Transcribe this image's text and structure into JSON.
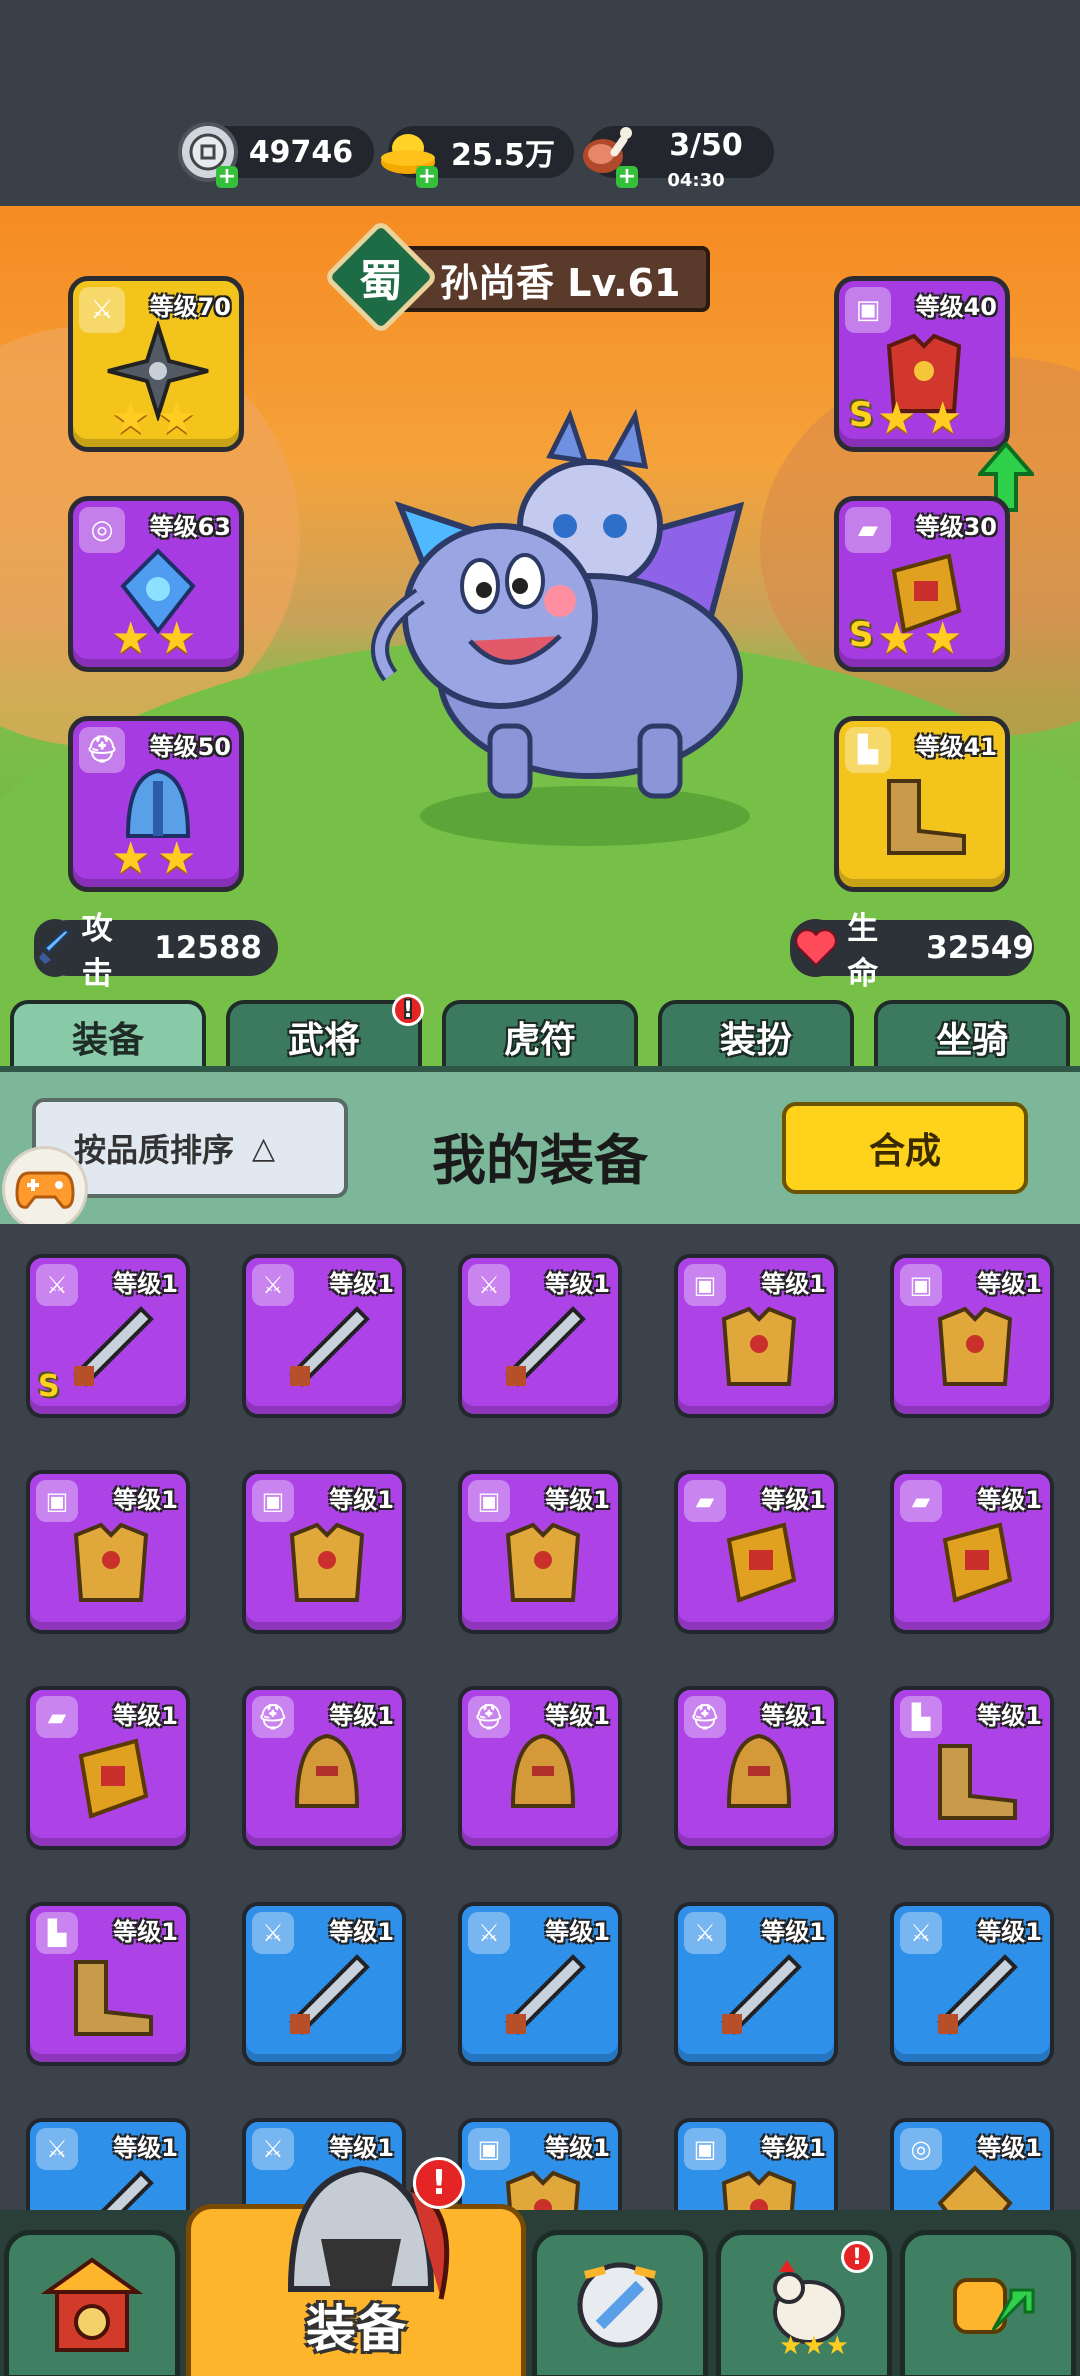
{
  "resources": [
    {
      "icon": "silver-coin-icon",
      "value": "49746"
    },
    {
      "icon": "gold-ingot-icon",
      "value": "25.5万"
    },
    {
      "icon": "meat-stamina-icon",
      "value": "3/50",
      "sub": "04:30"
    }
  ],
  "hero": {
    "kingdom": "蜀",
    "name": "孙尚香 Lv.61"
  },
  "equipped_left": [
    {
      "slot": "weapon",
      "level": "等级70",
      "color": "yellow",
      "stars": 2,
      "grade": ""
    },
    {
      "slot": "amulet",
      "level": "等级63",
      "color": "purple",
      "stars": 2,
      "grade": ""
    },
    {
      "slot": "helmet",
      "level": "等级50",
      "color": "purple",
      "stars": 2,
      "grade": ""
    }
  ],
  "equipped_right": [
    {
      "slot": "armor",
      "level": "等级40",
      "color": "purple",
      "stars": 2,
      "grade": "S"
    },
    {
      "slot": "bracer",
      "level": "等级30",
      "color": "purple",
      "stars": 2,
      "grade": "S"
    },
    {
      "slot": "boots",
      "level": "等级41",
      "color": "yellow",
      "stars": 0,
      "grade": ""
    }
  ],
  "stats": {
    "attack_label": "攻击",
    "attack_value": "12588",
    "hp_label": "生命",
    "hp_value": "32549"
  },
  "tabs": [
    {
      "label": "装备",
      "active": true
    },
    {
      "label": "武将",
      "badge": "!"
    },
    {
      "label": "虎符"
    },
    {
      "label": "装扮"
    },
    {
      "label": "坐骑"
    }
  ],
  "panel": {
    "sort_label": "按品质排序",
    "title": "我的装备",
    "combine_label": "合成"
  },
  "inventory": [
    {
      "slot": "weapon",
      "color": "purple",
      "level": "等级1",
      "grade": "S"
    },
    {
      "slot": "weapon",
      "color": "purple",
      "level": "等级1"
    },
    {
      "slot": "weapon",
      "color": "purple",
      "level": "等级1"
    },
    {
      "slot": "armor",
      "color": "purple",
      "level": "等级1"
    },
    {
      "slot": "armor",
      "color": "purple",
      "level": "等级1"
    },
    {
      "slot": "armor",
      "color": "purple",
      "level": "等级1"
    },
    {
      "slot": "armor",
      "color": "purple",
      "level": "等级1"
    },
    {
      "slot": "armor",
      "color": "purple",
      "level": "等级1"
    },
    {
      "slot": "bracer",
      "color": "purple",
      "level": "等级1"
    },
    {
      "slot": "bracer",
      "color": "purple",
      "level": "等级1"
    },
    {
      "slot": "bracer",
      "color": "purple",
      "level": "等级1"
    },
    {
      "slot": "helmet",
      "color": "purple",
      "level": "等级1"
    },
    {
      "slot": "helmet",
      "color": "purple",
      "level": "等级1"
    },
    {
      "slot": "helmet",
      "color": "purple",
      "level": "等级1"
    },
    {
      "slot": "boots",
      "color": "purple",
      "level": "等级1"
    },
    {
      "slot": "boots",
      "color": "purple",
      "level": "等级1"
    },
    {
      "slot": "weapon",
      "color": "blue",
      "level": "等级1"
    },
    {
      "slot": "weapon",
      "color": "blue",
      "level": "等级1"
    },
    {
      "slot": "weapon",
      "color": "blue",
      "level": "等级1"
    },
    {
      "slot": "weapon",
      "color": "blue",
      "level": "等级1"
    },
    {
      "slot": "weapon",
      "color": "blue",
      "level": "等级1"
    },
    {
      "slot": "weapon",
      "color": "blue",
      "level": "等级1"
    },
    {
      "slot": "armor",
      "color": "blue",
      "level": "等级1"
    },
    {
      "slot": "armor",
      "color": "blue",
      "level": "等级1"
    },
    {
      "slot": "amulet",
      "color": "blue",
      "level": "等级1"
    }
  ],
  "bottom_nav": [
    {
      "icon": "castle-gate-icon"
    },
    {
      "icon": "helmet-icon",
      "label": "装备",
      "active": true,
      "badge": "!"
    },
    {
      "icon": "battle-shield-icon"
    },
    {
      "icon": "rooster-icon",
      "badge": "!"
    },
    {
      "icon": "fist-upgrade-icon"
    }
  ]
}
